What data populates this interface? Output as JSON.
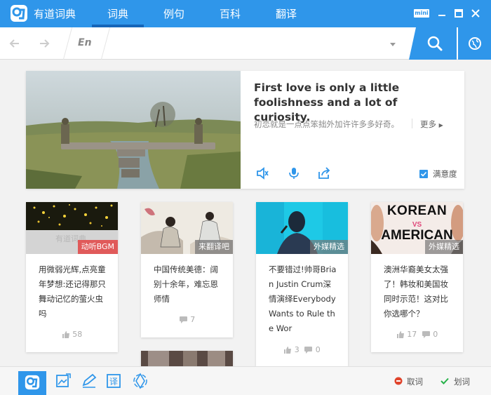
{
  "app": {
    "title": "有道词典"
  },
  "tabs": [
    {
      "label": "词典",
      "active": true
    },
    {
      "label": "例句",
      "active": false
    },
    {
      "label": "百科",
      "active": false
    },
    {
      "label": "翻译",
      "active": false
    }
  ],
  "window_controls": {
    "mini_label": "mini"
  },
  "search": {
    "lang": "En",
    "value": "",
    "placeholder": ""
  },
  "featured": {
    "quote_en": "First love is only a little foolishness and a lot of curiosity.",
    "quote_cn": "初恋就是一点点笨拙外加许许多多好奇。",
    "more_label": "更多",
    "satisfaction_label": "满意度",
    "satisfaction_checked": true
  },
  "cards": [
    {
      "tag": "动听BGM",
      "tag_color": "#e05a5a",
      "watermark": "有道词典",
      "title": "用微弱光辉,点亮童年梦想:还记得那只舞动记忆的萤火虫吗",
      "likes": "58",
      "comments": ""
    },
    {
      "tag": "来翻译吧",
      "tag_color": "rgba(120,120,120,0.75)",
      "title": "中国传统美德：阔别十余年，难忘恩师情",
      "likes": "",
      "comments": "7"
    },
    {
      "tag": "外媒精选",
      "tag_color": "rgba(120,120,120,0.7)",
      "title": "不要错过!帅哥Brian Justin Crum深情演绎Everybody Wants to Rule the Wor",
      "likes": "3",
      "comments": "0"
    },
    {
      "tag": "外媒精选",
      "tag_color": "rgba(120,120,120,0.7)",
      "title": "澳洲华裔美女太强了！韩妆和美国妆同时示范！这对比你选哪个？",
      "likes": "17",
      "comments": "0",
      "image_text_1": "KOREAN",
      "image_text_2": "VS",
      "image_text_3": "AMERICAN"
    }
  ],
  "bottom": {
    "cancel_label": "取词",
    "select_label": "划词"
  },
  "colors": {
    "accent": "#2f96ea",
    "accent_dark": "#1565b8"
  }
}
